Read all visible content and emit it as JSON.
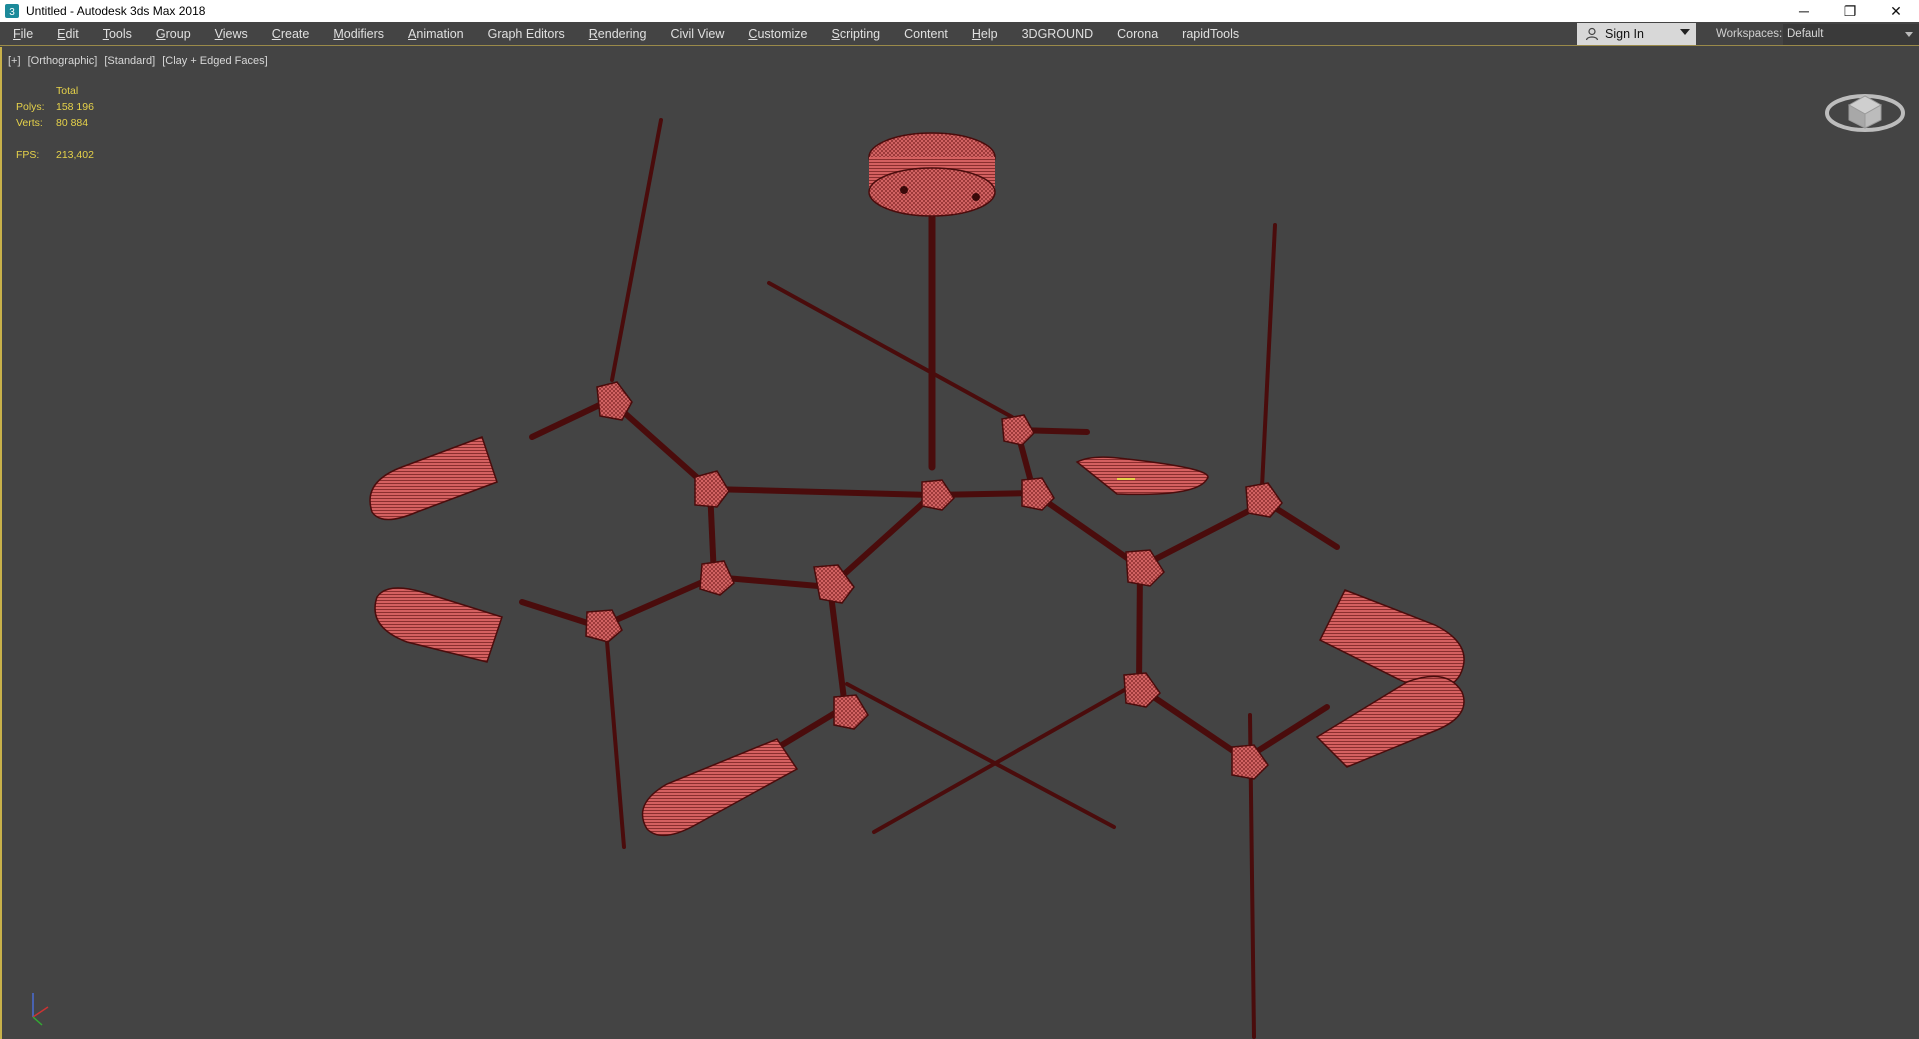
{
  "window": {
    "title": "Untitled - Autodesk 3ds Max 2018",
    "controls": {
      "minimize": "─",
      "restore": "❐",
      "close": "✕"
    }
  },
  "menu": [
    {
      "label": "File",
      "mn": "F",
      "rest": "ile"
    },
    {
      "label": "Edit",
      "mn": "E",
      "rest": "dit"
    },
    {
      "label": "Tools",
      "mn": "T",
      "rest": "ools"
    },
    {
      "label": "Group",
      "mn": "G",
      "rest": "roup"
    },
    {
      "label": "Views",
      "mn": "V",
      "rest": "iews"
    },
    {
      "label": "Create",
      "mn": "C",
      "rest": "reate"
    },
    {
      "label": "Modifiers",
      "mn": "M",
      "rest": "odifiers"
    },
    {
      "label": "Animation",
      "mn": "A",
      "rest": "nimation"
    },
    {
      "label": "Graph Editors",
      "mn": "",
      "rest": "Graph Editors"
    },
    {
      "label": "Rendering",
      "mn": "R",
      "rest": "endering"
    },
    {
      "label": "Civil View",
      "mn": "",
      "rest": "Civil View"
    },
    {
      "label": "Customize",
      "mn": "C",
      "rest": "ustomize"
    },
    {
      "label": "Scripting",
      "mn": "S",
      "rest": "cripting"
    },
    {
      "label": "Content",
      "mn": "",
      "rest": "Content"
    },
    {
      "label": "Help",
      "mn": "H",
      "rest": "elp"
    },
    {
      "label": "3DGROUND",
      "mn": "",
      "rest": "3DGROUND"
    },
    {
      "label": "Corona",
      "mn": "",
      "rest": "Corona"
    },
    {
      "label": "rapidTools",
      "mn": "",
      "rest": "rapidTools"
    }
  ],
  "account": {
    "sign_in": "Sign In"
  },
  "workspaces": {
    "label": "Workspaces:",
    "value": "Default"
  },
  "viewport": {
    "labels": [
      "[+]",
      "[Orthographic]",
      "[Standard]",
      "[Clay + Edged Faces]"
    ],
    "stats": {
      "header": "Total",
      "polys_label": "Polys:",
      "polys": "158 196",
      "verts_label": "Verts:",
      "verts": "80 884",
      "fps_label": "FPS:",
      "fps": "213,402"
    },
    "model_color": "#d86868",
    "wire_color": "#5a1010"
  },
  "icons": {
    "app": "3ds-max-icon",
    "user": "person-icon",
    "viewcube": "viewcube-icon",
    "axis": "axis-tripod-icon"
  }
}
